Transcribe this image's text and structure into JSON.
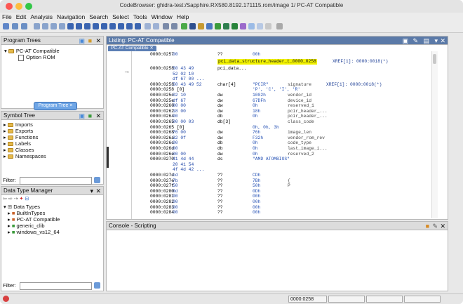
{
  "window": {
    "title": "CodeBrowser: ghidra-test:/Sapphire.RX580.8192.171115.rom/image 1/ PC-AT Compatible"
  },
  "menu": [
    "File",
    "Edit",
    "Analysis",
    "Navigation",
    "Search",
    "Select",
    "Tools",
    "Window",
    "Help"
  ],
  "program_trees": {
    "title": "Program Trees",
    "root": "PC-AT Compatible",
    "child": "Option ROM",
    "tab_label": "Program Tree",
    "tab_close": "×"
  },
  "symbol_tree": {
    "title": "Symbol Tree",
    "items": [
      "Imports",
      "Exports",
      "Functions",
      "Labels",
      "Classes",
      "Namespaces"
    ],
    "filter_label": "Filter:"
  },
  "data_type_manager": {
    "title": "Data Type Manager",
    "root": "Data Types",
    "items": [
      "BuiltInTypes",
      "PC-AT Compatible",
      "generic_clib",
      "windows_vs12_64"
    ],
    "filter_label": "Filter:"
  },
  "listing": {
    "title": "Listing:  PC-AT Compatible",
    "tab": "PC-AT Compatible",
    "label": "pci_data_structure_header_t_0000_0258",
    "label_xref": "XREF[1]:     0000:0018(*)",
    "lines": [
      {
        "a": "0000:0257",
        "b": "00",
        "m": "??",
        "o": "00h",
        "c": "",
        "x": ""
      },
      {
        "a": "0000:0258",
        "b": "50 43 49",
        "m": "pci_data...",
        "o": "",
        "c": "",
        "x": ""
      },
      {
        "a": "",
        "b": "52 02 10",
        "m": "",
        "o": "",
        "c": "",
        "x": ""
      },
      {
        "a": "",
        "b": "df 67 00 ...",
        "m": "",
        "o": "",
        "c": "",
        "x": ""
      },
      {
        "a": "0000:0258",
        "b": "50 43 49 52",
        "m": "char[4]",
        "o": "\"PCIR\"",
        "c": "signature",
        "x": "XREF[1]:     0000:0018(*)"
      },
      {
        "a": "  0000:0258 [0]",
        "b": "",
        "m": "",
        "o": "'P', 'C', 'I', 'R'",
        "c": "",
        "x": ""
      },
      {
        "a": "0000:025c",
        "b": "02 10",
        "m": "dw",
        "o": "1002h",
        "c": "vendor_id",
        "x": ""
      },
      {
        "a": "0000:025e",
        "b": "df 67",
        "m": "dw",
        "o": "67DFh",
        "c": "device_id",
        "x": ""
      },
      {
        "a": "0000:0260",
        "b": "00 00",
        "m": "dw",
        "o": "0h",
        "c": "reserved_1",
        "x": ""
      },
      {
        "a": "0000:0262",
        "b": "18 00",
        "m": "dw",
        "o": "18h",
        "c": "pcir_header_...",
        "x": ""
      },
      {
        "a": "0000:0264",
        "b": "00",
        "m": "db",
        "o": "0h",
        "c": "pcir_header_...",
        "x": ""
      },
      {
        "a": "0000:0265",
        "b": "00 00 03",
        "m": "db[3]",
        "o": "",
        "c": "class_code",
        "x": ""
      },
      {
        "a": "  0000:0265 [0]",
        "b": "",
        "m": "",
        "o": "0h, 0h, 3h",
        "c": "",
        "x": ""
      },
      {
        "a": "0000:0268",
        "b": "76 00",
        "m": "dw",
        "o": "76h",
        "c": "image_len",
        "x": ""
      },
      {
        "a": "0000:026a",
        "b": "32 0f",
        "m": "dw",
        "o": "F32h",
        "c": "vendor_rom_rev",
        "x": ""
      },
      {
        "a": "0000:026c",
        "b": "00",
        "m": "db",
        "o": "0h",
        "c": "code_type",
        "x": ""
      },
      {
        "a": "0000:026d",
        "b": "00",
        "m": "db",
        "o": "0h",
        "c": "last_image_i...",
        "x": ""
      },
      {
        "a": "0000:026e",
        "b": "00 00",
        "m": "dw",
        "o": "0h",
        "c": "reserved_2",
        "x": ""
      },
      {
        "a": "0000:0270",
        "b": "41 4d 44",
        "m": "ds",
        "o": "\"AMD ATOMBIOS\"",
        "c": "",
        "x": ""
      },
      {
        "a": "",
        "b": "20 41 54",
        "m": "",
        "o": "",
        "c": "",
        "x": ""
      },
      {
        "a": "",
        "b": "4f 4d 42 ...",
        "m": "",
        "o": "",
        "c": "",
        "x": ""
      },
      {
        "a": "0000:027d",
        "b": "cd",
        "m": "??",
        "o": "CDh",
        "c": "",
        "x": ""
      },
      {
        "a": "0000:027e",
        "b": "7b",
        "m": "??",
        "o": "7Bh",
        "c": "{",
        "x": ""
      },
      {
        "a": "0000:027f",
        "b": "50",
        "m": "??",
        "o": "50h",
        "c": "P",
        "x": ""
      },
      {
        "a": "0000:0280",
        "b": "0d",
        "m": "??",
        "o": "0Dh",
        "c": "",
        "x": ""
      },
      {
        "a": "0000:0281",
        "b": "00",
        "m": "??",
        "o": "00h",
        "c": "",
        "x": ""
      },
      {
        "a": "0000:0282",
        "b": "00",
        "m": "??",
        "o": "00h",
        "c": "",
        "x": ""
      },
      {
        "a": "0000:0283",
        "b": "00",
        "m": "??",
        "o": "00h",
        "c": "",
        "x": ""
      },
      {
        "a": "0000:0284",
        "b": "00",
        "m": "??",
        "o": "00h",
        "c": "",
        "x": ""
      }
    ]
  },
  "console": {
    "title": "Console - Scripting"
  },
  "status": {
    "address": "0000:0258"
  }
}
